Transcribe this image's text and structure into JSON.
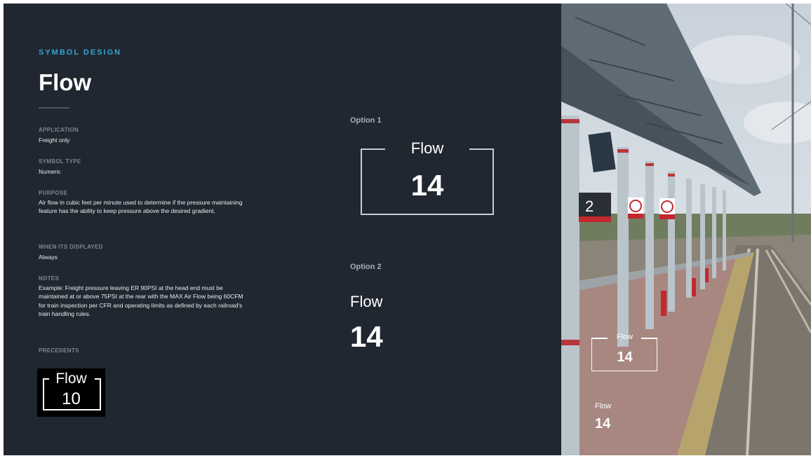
{
  "header": {
    "eyebrow": "SYMBOL DESIGN",
    "title": "Flow"
  },
  "fields": {
    "application": {
      "label": "APPLICATION",
      "value": "Freight only"
    },
    "symbol_type": {
      "label": "SYMBOL TYPE",
      "value": "Numeric"
    },
    "purpose": {
      "label": "PURPOSE",
      "value": "Air flow in cubic feet per minute used to determine if the pressure maintaining feature has the ability to keep pressure above the desired gradient."
    },
    "when_displayed": {
      "label": "WHEN ITS DISPLAYED",
      "value": "Always"
    },
    "notes": {
      "label": "NOTES",
      "value": "Example: Freight pressure leaving ER 90PSI at the head end must be maintained at or above 75PSI at the rear with the MAX Air Flow being 60CFM for train inspection per CFR and operating limits as defined by each railroad's train handling rules."
    },
    "precedents": {
      "label": "PRECEDENTS"
    }
  },
  "precedent_symbol": {
    "title": "Flow",
    "value": "10"
  },
  "option1": {
    "label": "Option 1",
    "symbol_title": "Flow",
    "symbol_value": "14"
  },
  "option2": {
    "label": "Option 2",
    "symbol_title": "Flow",
    "symbol_value": "14"
  },
  "photo": {
    "platform_sign_number": "2",
    "overlay1": {
      "title": "Flow",
      "value": "14"
    },
    "overlay2": {
      "title": "Flow",
      "value": "14"
    }
  },
  "colors": {
    "background": "#212730",
    "accent": "#2fa3d6",
    "label": "#7d8693",
    "text": "#e9ecef"
  }
}
